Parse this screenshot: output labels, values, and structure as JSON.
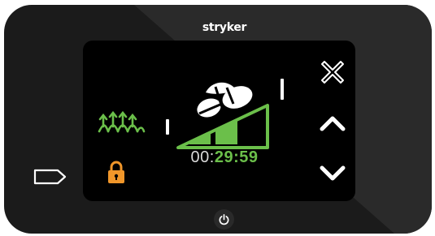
{
  "device": {
    "brand": "stryker",
    "icons": {
      "tag": "tag-outline-icon",
      "power": "power-icon"
    }
  },
  "screen": {
    "status_icons": {
      "mode": "air-pump-waves-icon",
      "lock": "lock-icon"
    },
    "controls": {
      "close": "close-x-icon",
      "up": "chevron-up-icon",
      "down": "chevron-down-icon"
    },
    "timer": {
      "prefix": "00:",
      "value": "29:59"
    },
    "colors": {
      "accent_green": "#6bbf4a",
      "lock_orange": "#f0962a",
      "text_white": "#ffffff"
    }
  }
}
